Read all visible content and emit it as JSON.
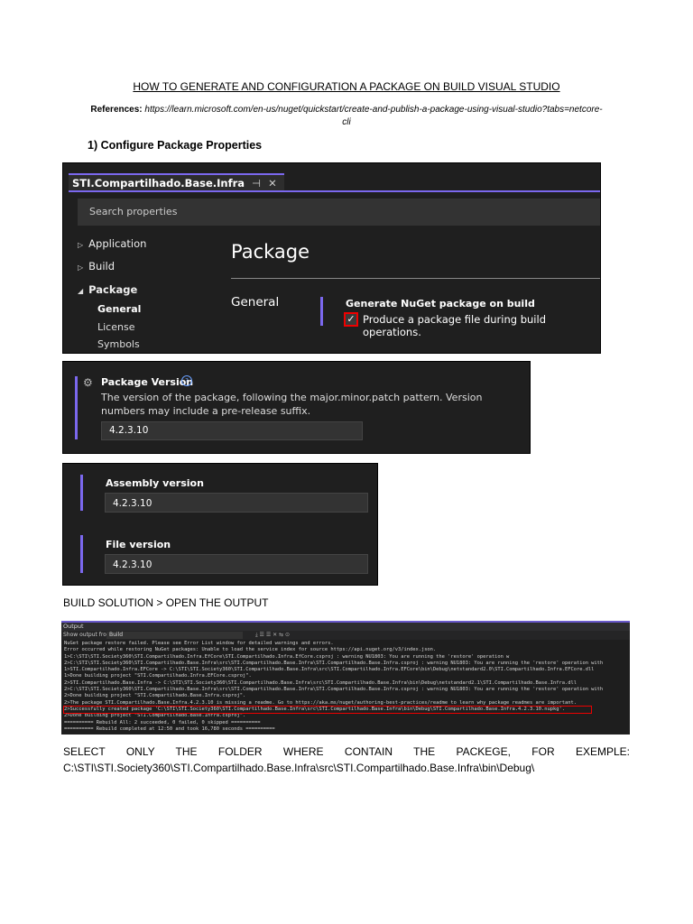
{
  "doc": {
    "title": "HOW TO GENERATE AND CONFIGURATION A PACKAGE ON BUILD VISUAL STUDIO",
    "references_label": "References:",
    "references_url": "https://learn.microsoft.com/en-us/nuget/quickstart/create-and-publish-a-package-using-visual-studio?tabs=netcore-cli",
    "section1": "1)   Configure Package Properties",
    "build_step": "BUILD SOLUTION > OPEN THE OUTPUT",
    "select_line1": "SELECT ONLY THE FOLDER WHERE CONTAIN THE PACKEGE, FOR EXEMPLE:",
    "select_line2": "C:\\STI\\STI.Society360\\STI.Compartilhado.Base.Infra\\src\\STI.Compartilhado.Base.Infra\\bin\\Debug\\"
  },
  "props": {
    "tab_title": "STI.Compartilhado.Base.Infra",
    "tab_pin": "⊣",
    "tab_close": "✕",
    "search_placeholder": "Search properties",
    "nav": [
      {
        "label": "Application",
        "arrow": "▷"
      },
      {
        "label": "Build",
        "arrow": "▷"
      },
      {
        "label": "Package",
        "arrow": "◢"
      }
    ],
    "subnav": [
      "General",
      "License",
      "Symbols"
    ],
    "page_heading": "Package",
    "section": "General",
    "generate_label": "Generate NuGet package on build",
    "checkbox_label": "Produce a package file during build operations.",
    "checked": true
  },
  "version": {
    "label": "Package Version",
    "help": "?",
    "description": "The version of the package, following the major.minor.patch pattern. Version numbers may include a pre-release suffix.",
    "value": "4.2.3.10"
  },
  "assembly": {
    "assembly_label": "Assembly version",
    "assembly_value": "4.2.3.10",
    "file_label": "File version",
    "file_value": "4.2.3.10"
  },
  "output": {
    "title": "Output",
    "show_from_label": "Show output from:",
    "source": "Build",
    "lines": [
      "NuGet package restore failed. Please see Error List window for detailed warnings and errors.",
      "Error occurred while restoring NuGet packages: Unable to load the service index for source https://api.nuget.org/v3/index.json.",
      "1>C:\\STI\\STI.Society360\\STI.Compartilhado.Infra.EfCore\\STI.Compartilhado.Infra.EfCore.csproj : warning NU1803: You are running the 'restore' operation w",
      "2>C:\\STI\\STI.Society360\\STI.Compartilhado.Base.Infra\\src\\STI.Compartilhado.Base.Infra\\STI.Compartilhado.Base.Infra.csproj : warning NU1803: You are running the 'restore' operation with",
      "1>STI.Compartilhado.Infra.EFCore -> C:\\STI\\STI.Society360\\STI.Compartilhado.Base.Infra\\src\\STI.Compartilhado.Infra.EFCore\\bin\\Debug\\netstandard2.0\\STI.Compartilhado.Infra.EFCore.dll",
      "1>Done building project \"STI.Compartilhado.Infra.EFCore.csproj\".",
      "2>STI.Compartilhado.Base.Infra -> C:\\STI\\STI.Society360\\STI.Compartilhado.Base.Infra\\src\\STI.Compartilhado.Base.Infra\\bin\\Debug\\netstandard2.1\\STI.Compartilhado.Base.Infra.dll",
      "2>C:\\STI\\STI.Society360\\STI.Compartilhado.Base.Infra\\src\\STI.Compartilhado.Base.Infra\\STI.Compartilhado.Base.Infra.csproj : warning NU1803: You are running the 'restore' operation with",
      "2>Done building project \"STI.Compartilhado.Base.Infra.csproj\".",
      "2>The package STI.Compartilhado.Base.Infra.4.2.3.10 is missing a readme. Go to https://aka.ms/nuget/authoring-best-practices/readme to learn why package readmes are important.",
      "2>Successfully created package 'C:\\STI\\STI.Society360\\STI.Compartilhado.Base.Infra\\src\\STI.Compartilhado.Base.Infra\\bin\\Debug\\STI.Compartilhado.Base.Infra.4.2.3.10.nupkg'.",
      "2>Done building project \"STI.Compartilhado.Base.Infra.csproj\".",
      "========== Rebuild All: 2 succeeded, 0 failed, 0 skipped ==========",
      "========== Rebuild completed at 12:50 and took 16,780 seconds =========="
    ],
    "highlight_index": 10
  }
}
